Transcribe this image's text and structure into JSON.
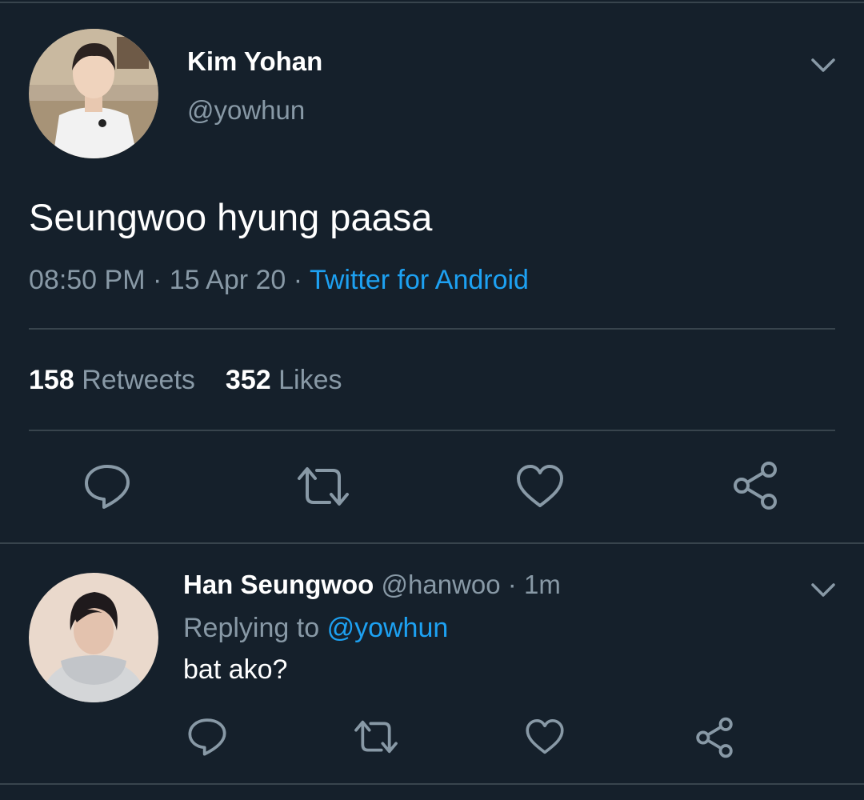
{
  "colors": {
    "background": "#15202b",
    "primary_text": "#ffffff",
    "secondary_text": "#8899a6",
    "link": "#1da1f2",
    "divider": "#38444d"
  },
  "main_tweet": {
    "display_name": "Kim Yohan",
    "handle": "@yowhun",
    "avatar": "profile-photo",
    "text": "Seungwoo hyung paasa",
    "time": "08:50 PM",
    "date": "15 Apr 20",
    "separator": "·",
    "source": "Twitter for Android",
    "retweet_count": "158",
    "retweet_label": "Retweets",
    "like_count": "352",
    "like_label": "Likes",
    "menu_icon": "chevron-down-icon",
    "actions": [
      "reply-icon",
      "retweet-icon",
      "like-icon",
      "share-icon"
    ]
  },
  "reply_tweet": {
    "display_name": "Han Seungwoo",
    "handle": "@hanwoo",
    "time_ago": "1m",
    "separator": "·",
    "avatar": "profile-photo",
    "replying_label": "Replying to",
    "replying_to": "@yowhun",
    "text": "bat ako?",
    "menu_icon": "chevron-down-icon",
    "actions": [
      "reply-icon",
      "retweet-icon",
      "like-icon",
      "share-icon"
    ]
  }
}
